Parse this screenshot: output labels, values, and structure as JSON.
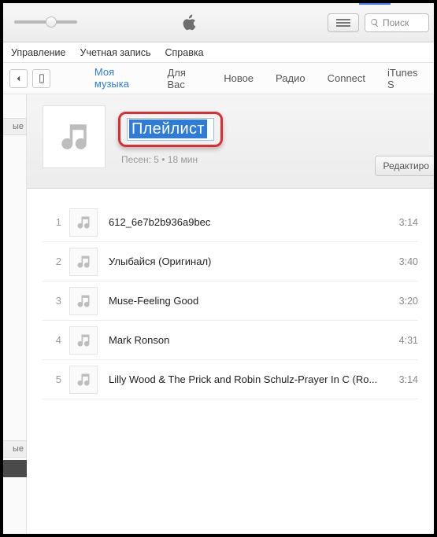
{
  "search": {
    "placeholder": "Поиск"
  },
  "menu": {
    "manage": "Управление",
    "account": "Учетная запись",
    "help": "Справка"
  },
  "tabs": {
    "my_music": "Моя музыка",
    "for_you": "Для Вас",
    "new": "Новое",
    "radio": "Радио",
    "connect": "Connect",
    "store": "iTunes S"
  },
  "sidebar": {
    "stub1": "ые",
    "stub2": "ые"
  },
  "playlist": {
    "name": "Плейлист",
    "meta": "Песен: 5 • 18 мин",
    "edit_label": "Редактиро"
  },
  "tracks": [
    {
      "n": "1",
      "title": "612_6e7b2b936a9bec",
      "dur": "3:14"
    },
    {
      "n": "2",
      "title": "Улыбайся (Оригинал)",
      "dur": "3:40"
    },
    {
      "n": "3",
      "title": "Muse-Feeling Good",
      "dur": "3:20"
    },
    {
      "n": "4",
      "title": "Mark Ronson",
      "dur": "4:31"
    },
    {
      "n": "5",
      "title": "Lilly Wood & The Prick and Robin Schulz-Prayer In C (Ro...",
      "dur": "3:14"
    }
  ]
}
